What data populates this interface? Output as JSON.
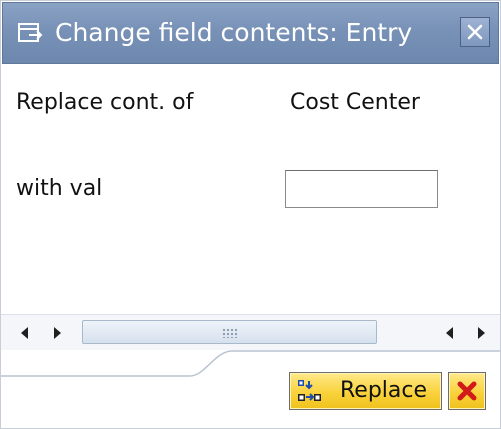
{
  "dialog": {
    "title": "Change field contents: Entry",
    "title_icon": "dialog-window-icon",
    "close_icon": "close-icon"
  },
  "form": {
    "replace_label": "Replace cont. of",
    "field_name": "Cost Center",
    "with_label": "with val",
    "with_value": "",
    "with_placeholder": ""
  },
  "scrollbar": {
    "left_icon": "arrow-left-icon",
    "right_icon": "arrow-right-icon"
  },
  "buttons": {
    "replace_label": "Replace",
    "replace_icon": "replace-icon",
    "cancel_icon": "cancel-icon"
  },
  "colors": {
    "titlebar": "#7891b7",
    "button_yellow": "#f9d23c",
    "cancel_red": "#d11a1a"
  }
}
